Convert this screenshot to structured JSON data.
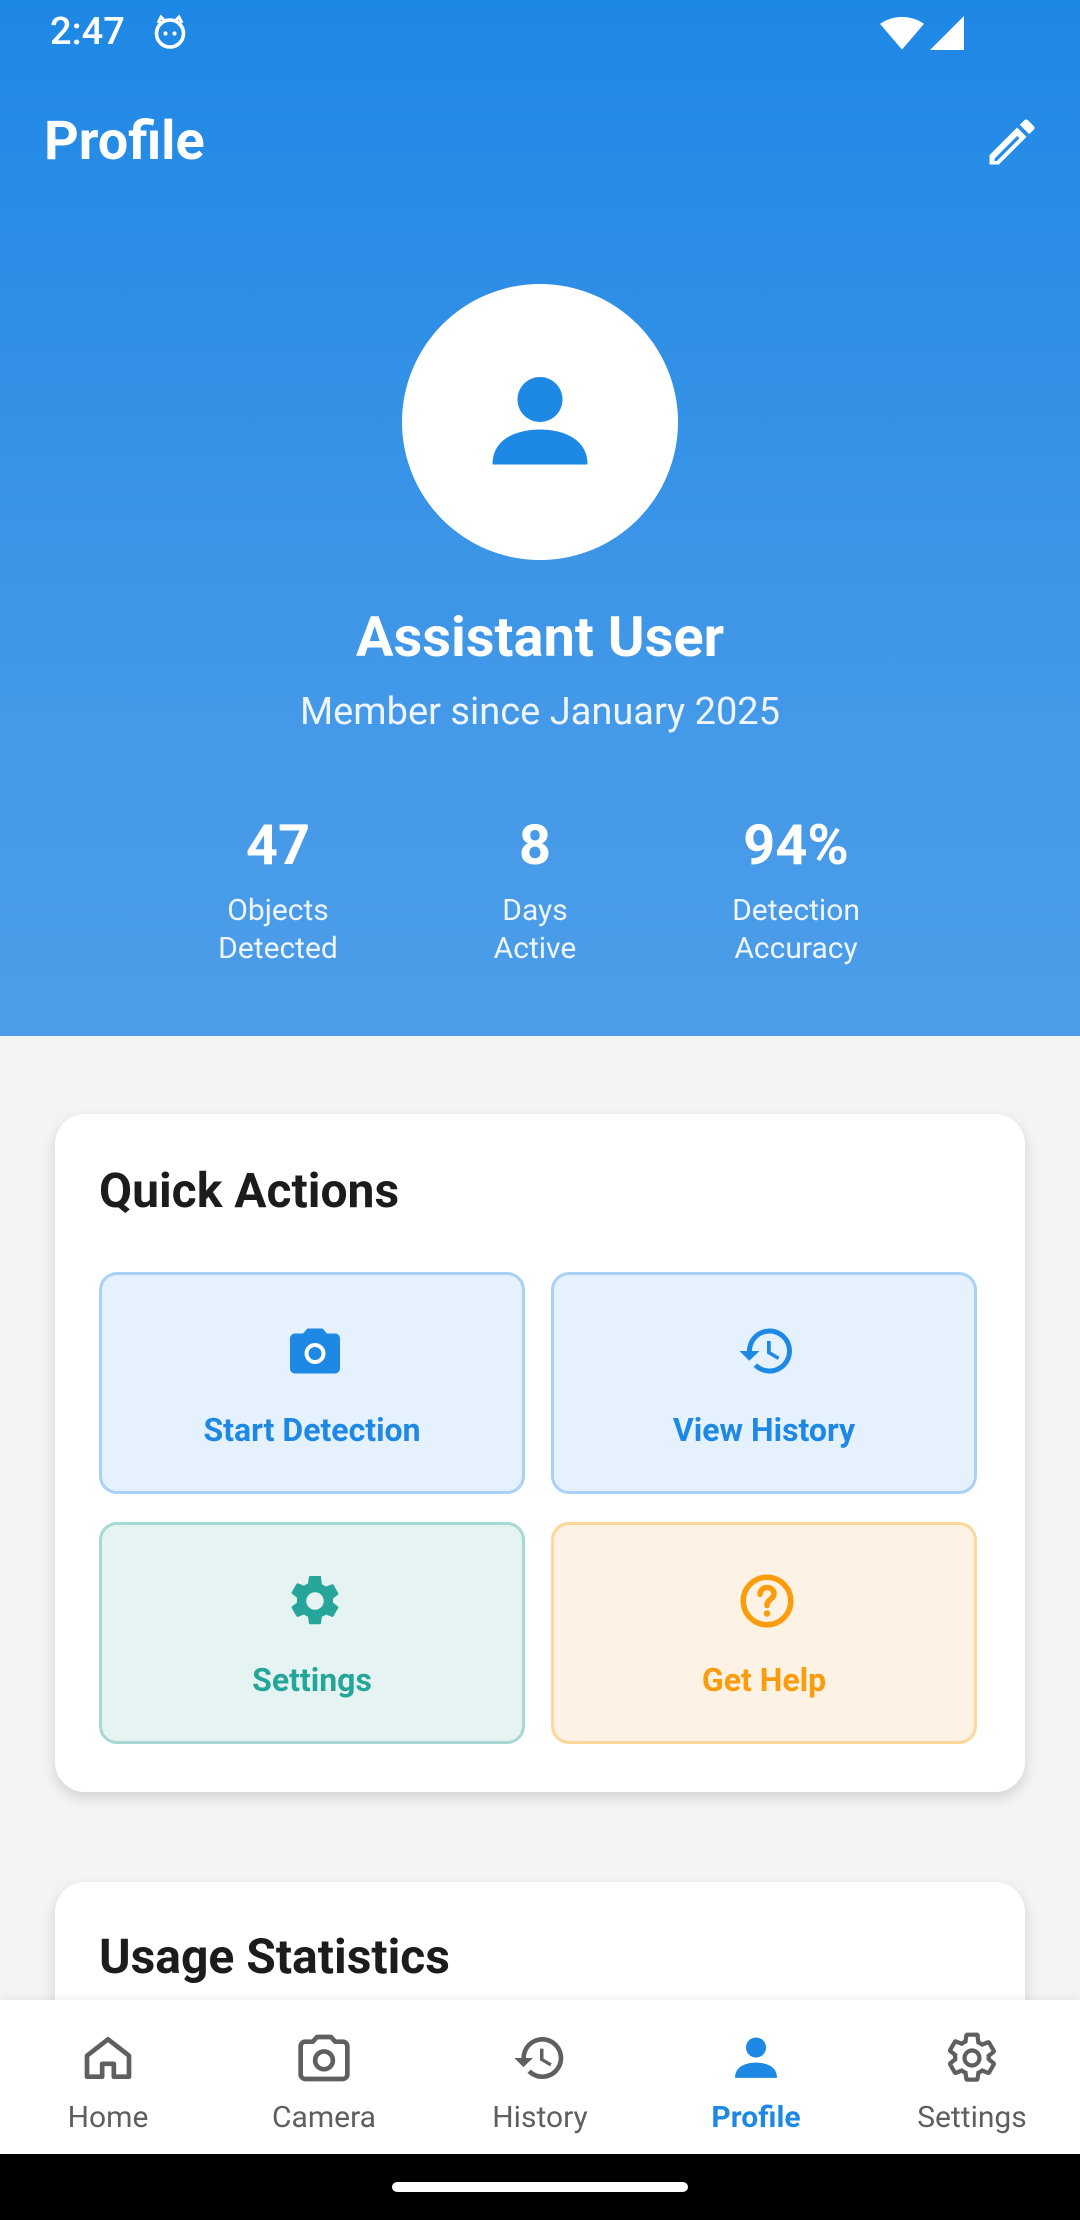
{
  "status_bar": {
    "time": "2:47"
  },
  "header": {
    "title": "Profile"
  },
  "profile": {
    "name": "Assistant User",
    "member_since": "Member since January 2025",
    "stats": [
      {
        "value": "47",
        "line1": "Objects",
        "line2": "Detected"
      },
      {
        "value": "8",
        "line1": "Days",
        "line2": "Active"
      },
      {
        "value": "94%",
        "line1": "Detection",
        "line2": "Accuracy"
      }
    ]
  },
  "quick_actions": {
    "title": "Quick Actions",
    "items": [
      {
        "label": "Start Detection",
        "icon": "camera-icon",
        "color": "#1e88e5"
      },
      {
        "label": "View History",
        "icon": "history-icon",
        "color": "#1e88e5"
      },
      {
        "label": "Settings",
        "icon": "gear-icon",
        "color": "#26a69a"
      },
      {
        "label": "Get Help",
        "icon": "help-icon",
        "color": "#fb9c0c"
      }
    ]
  },
  "usage_statistics": {
    "title": "Usage Statistics"
  },
  "bottom_nav": {
    "items": [
      {
        "label": "Home",
        "icon": "home-icon",
        "active": false
      },
      {
        "label": "Camera",
        "icon": "camera-icon",
        "active": false
      },
      {
        "label": "History",
        "icon": "history-icon",
        "active": false
      },
      {
        "label": "Profile",
        "icon": "person-icon",
        "active": true
      },
      {
        "label": "Settings",
        "icon": "gear-icon",
        "active": false
      }
    ]
  },
  "colors": {
    "primary": "#1e88e5",
    "teal": "#26a69a",
    "orange": "#fb9c0c",
    "inactive": "#5f5f5f"
  }
}
